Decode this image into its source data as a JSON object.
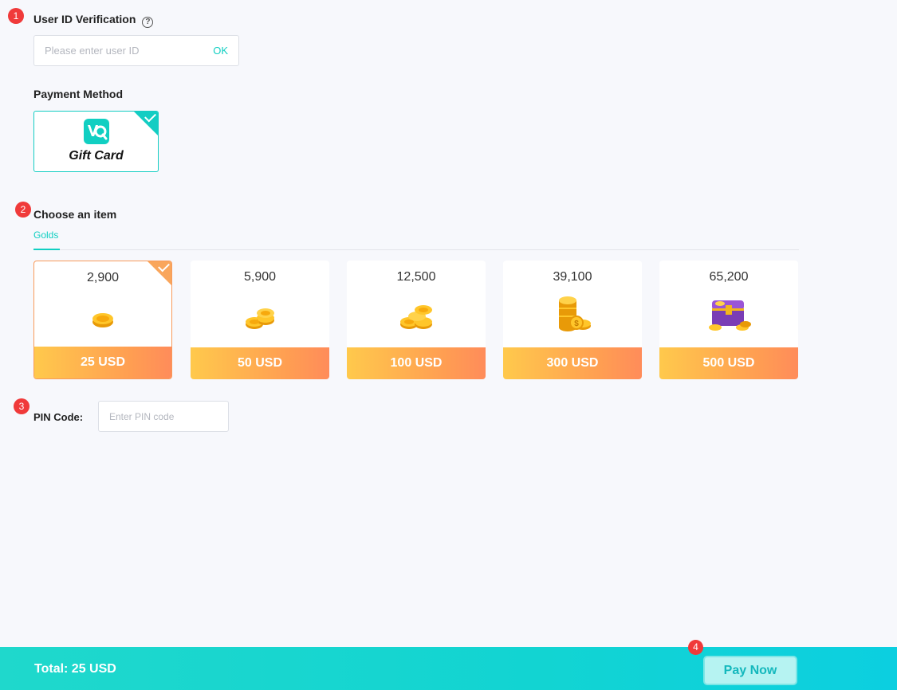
{
  "steps": [
    "1",
    "2",
    "3",
    "4"
  ],
  "user_id": {
    "title": "User ID Verification",
    "help_icon": "question-circle-icon",
    "placeholder": "Please enter user ID",
    "ok_label": "OK"
  },
  "payment": {
    "title": "Payment Method",
    "method": {
      "label": "Gift Card",
      "icon": "gift-card-logo-icon",
      "selected": true
    }
  },
  "items_section": {
    "title": "Choose an item",
    "tab": "Golds",
    "items": [
      {
        "amount": "2,900",
        "price": "25 USD",
        "selected": true,
        "icon": "single-coin-icon"
      },
      {
        "amount": "5,900",
        "price": "50 USD",
        "selected": false,
        "icon": "coin-pile-small-icon"
      },
      {
        "amount": "12,500",
        "price": "100 USD",
        "selected": false,
        "icon": "coin-pile-medium-icon"
      },
      {
        "amount": "39,100",
        "price": "300 USD",
        "selected": false,
        "icon": "coin-stack-large-icon"
      },
      {
        "amount": "65,200",
        "price": "500 USD",
        "selected": false,
        "icon": "treasure-chest-icon"
      }
    ]
  },
  "pin": {
    "label": "PIN Code:",
    "placeholder": "Enter PIN code"
  },
  "footer": {
    "total": "Total: 25 USD",
    "pay_label": "Pay Now"
  },
  "colors": {
    "accent": "#11cfc2",
    "badge": "#f03a3a",
    "price_gradient_start": "#ffc94c",
    "price_gradient_end": "#ff8c5a"
  }
}
